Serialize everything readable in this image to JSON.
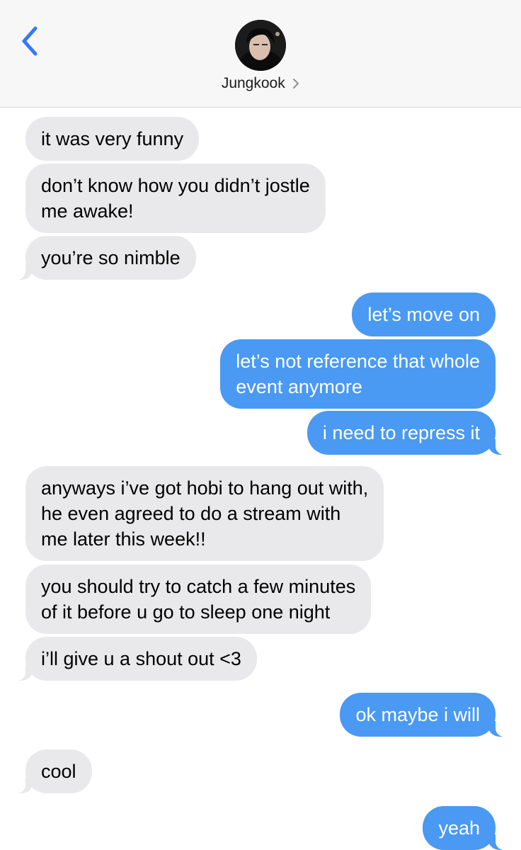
{
  "header": {
    "contact_name": "Jungkook",
    "back_icon": "chevron-left-icon",
    "detail_icon": "chevron-right-icon"
  },
  "messages": [
    {
      "from": "them",
      "text": "it was very funny"
    },
    {
      "from": "them",
      "text": "don’t know how you didn’t jostle\nme awake!"
    },
    {
      "from": "them",
      "text": "you’re so nimble"
    },
    {
      "from": "me",
      "text": "let’s move on"
    },
    {
      "from": "me",
      "text": "let’s not reference that whole\nevent anymore"
    },
    {
      "from": "me",
      "text": "i need to repress it"
    },
    {
      "from": "them",
      "text": "anyways i’ve got hobi to hang out with,\nhe even agreed to do a stream with\nme later this week!!"
    },
    {
      "from": "them",
      "text": "you should try to catch a few minutes\nof it before u go to sleep one night"
    },
    {
      "from": "them",
      "text": "i’ll give u a shout out <3"
    },
    {
      "from": "me",
      "text": "ok maybe i will"
    },
    {
      "from": "them",
      "text": "cool"
    },
    {
      "from": "me",
      "text": "yeah"
    }
  ],
  "colors": {
    "incoming_bubble": "#e9e9eb",
    "outgoing_bubble": "#4a99f2",
    "accent": "#3478f6"
  }
}
